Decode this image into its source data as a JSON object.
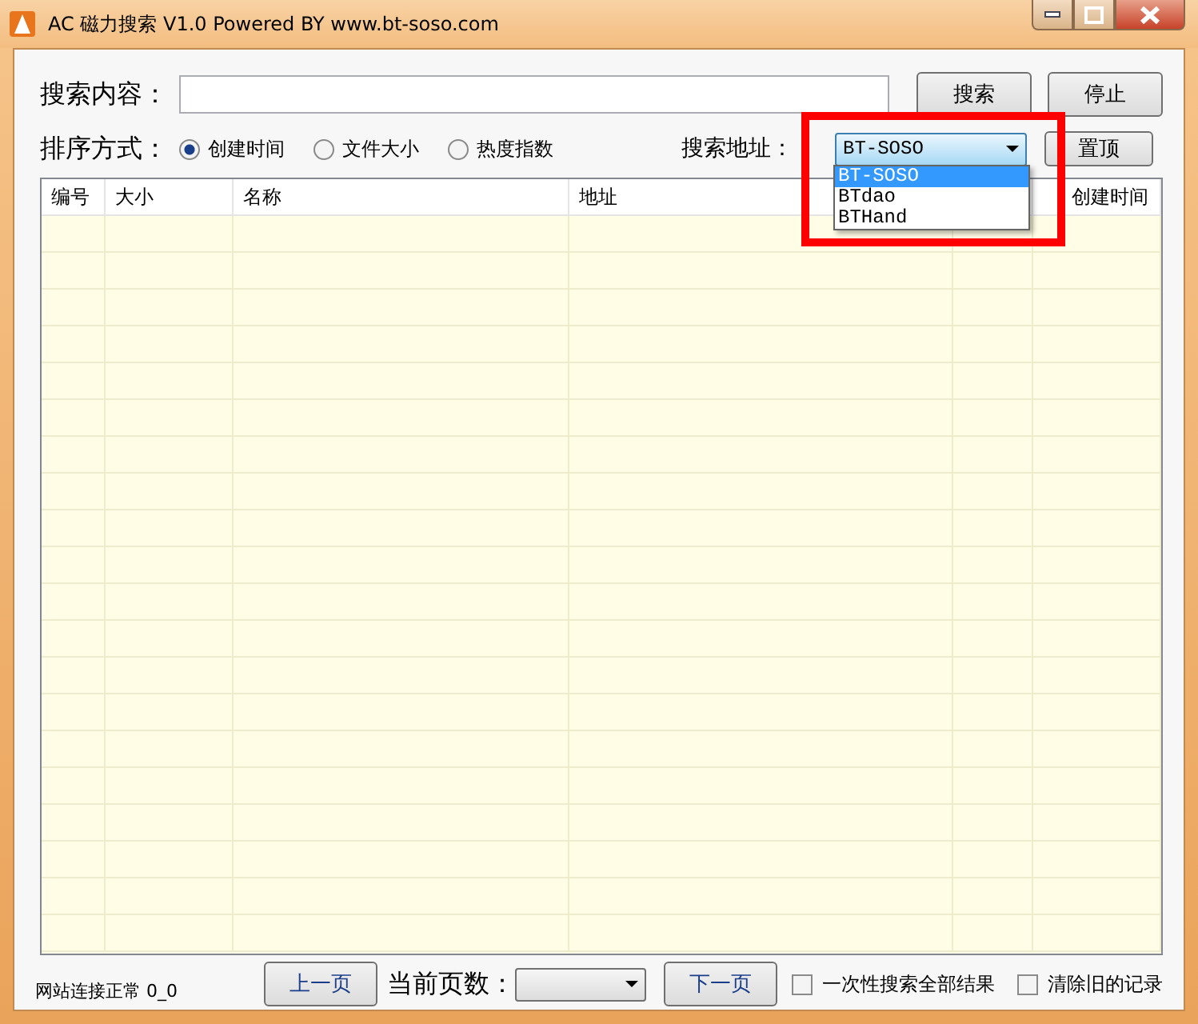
{
  "window": {
    "title": "AC 磁力搜索 V1.0 Powered BY www.bt-soso.com"
  },
  "search": {
    "label": "搜索内容：",
    "buttons": [
      "搜索",
      "停止"
    ]
  },
  "sort": {
    "label": "排序方式：",
    "options": [
      {
        "label": "创建时间",
        "selected": true
      },
      {
        "label": "文件大小",
        "selected": false
      },
      {
        "label": "热度指数",
        "selected": false
      }
    ]
  },
  "source": {
    "label": "搜索地址：",
    "value": "BT-SOSO",
    "expanded": true,
    "options": [
      {
        "label": "BT-SOSO",
        "selected": true
      },
      {
        "label": "BTdao",
        "selected": false
      },
      {
        "label": "BTHand",
        "selected": false
      }
    ]
  },
  "pin_button": "置顶",
  "table": {
    "columns": [
      "编号",
      "大小",
      "名称",
      "地址",
      "创建时间"
    ]
  },
  "status": "网站连接正常 0_0",
  "pager": {
    "prev": "上一页",
    "label": "当前页数：",
    "next": "下一页"
  },
  "options": [
    {
      "label": "一次性搜索全部结果",
      "checked": false
    },
    {
      "label": "清除旧的记录",
      "checked": false
    }
  ]
}
